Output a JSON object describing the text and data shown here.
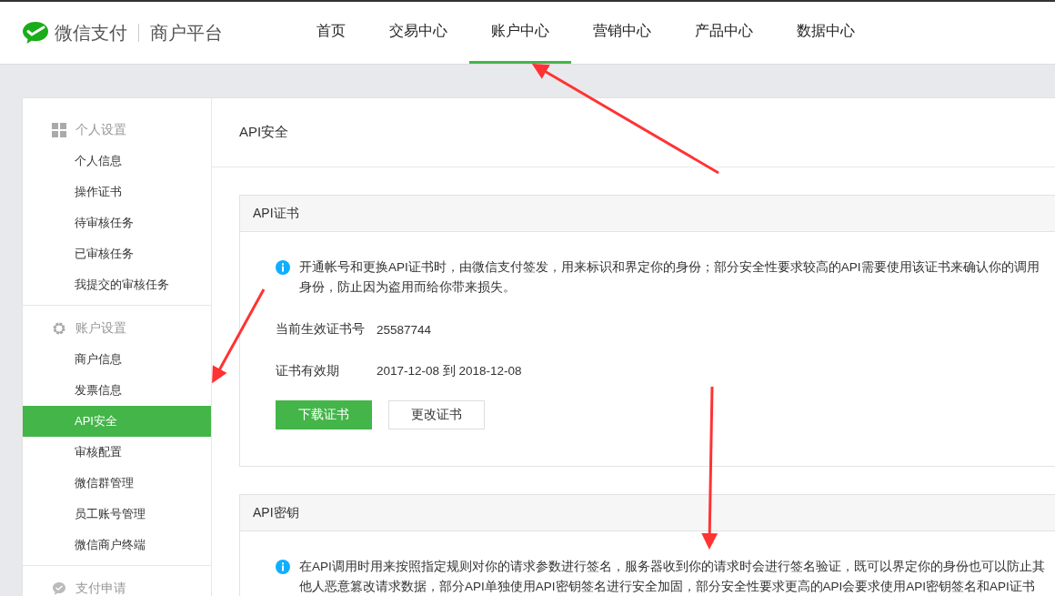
{
  "brand": {
    "name": "微信支付",
    "product": "商户平台"
  },
  "nav": [
    {
      "label": "首页",
      "selected": false
    },
    {
      "label": "交易中心",
      "selected": false
    },
    {
      "label": "账户中心",
      "selected": true
    },
    {
      "label": "营销中心",
      "selected": false
    },
    {
      "label": "产品中心",
      "selected": false
    },
    {
      "label": "数据中心",
      "selected": false
    }
  ],
  "sidebar": [
    {
      "title": "个人设置",
      "kind": "grid",
      "items": [
        {
          "label": "个人信息",
          "selected": false
        },
        {
          "label": "操作证书",
          "selected": false
        },
        {
          "label": "待审核任务",
          "selected": false
        },
        {
          "label": "已审核任务",
          "selected": false
        },
        {
          "label": "我提交的审核任务",
          "selected": false
        }
      ]
    },
    {
      "title": "账户设置",
      "kind": "gear",
      "items": [
        {
          "label": "商户信息",
          "selected": false
        },
        {
          "label": "发票信息",
          "selected": false
        },
        {
          "label": "API安全",
          "selected": true
        },
        {
          "label": "审核配置",
          "selected": false
        },
        {
          "label": "微信群管理",
          "selected": false
        },
        {
          "label": "员工账号管理",
          "selected": false
        },
        {
          "label": "微信商户终端",
          "selected": false
        }
      ]
    },
    {
      "title": "支付申请",
      "kind": "chat"
    }
  ],
  "page_title": "API安全",
  "cards": [
    {
      "title": "API证书",
      "notice": [
        "开通帐号和更换API证书时，由微信支付签发，用来标识和界定你的身份；部分安全性要求较高的API需要使用该证书来确认你的调用",
        "身份，防止因为盗用而给你带来损失。"
      ],
      "fields": [
        {
          "label": "当前生效证书号",
          "value": "25587744"
        },
        {
          "label": "证书有效期",
          "value": "2017-12-08  到  2018-12-08"
        }
      ],
      "buttons": [
        {
          "label": "下载证书",
          "kind": "primary"
        },
        {
          "label": "更改证书",
          "kind": "default"
        }
      ]
    },
    {
      "title": "API密钥",
      "notice": [
        "在API调用时用来按照指定规则对你的请求参数进行签名，服务器收到你的请求时会进行签名验证，既可以界定你的身份也可以防止其",
        "他人恶意篡改请求数据，部分API单独使用API密钥签名进行安全加固，部分安全性要求更高的API会要求使用API密钥签名和API证书"
      ]
    }
  ]
}
